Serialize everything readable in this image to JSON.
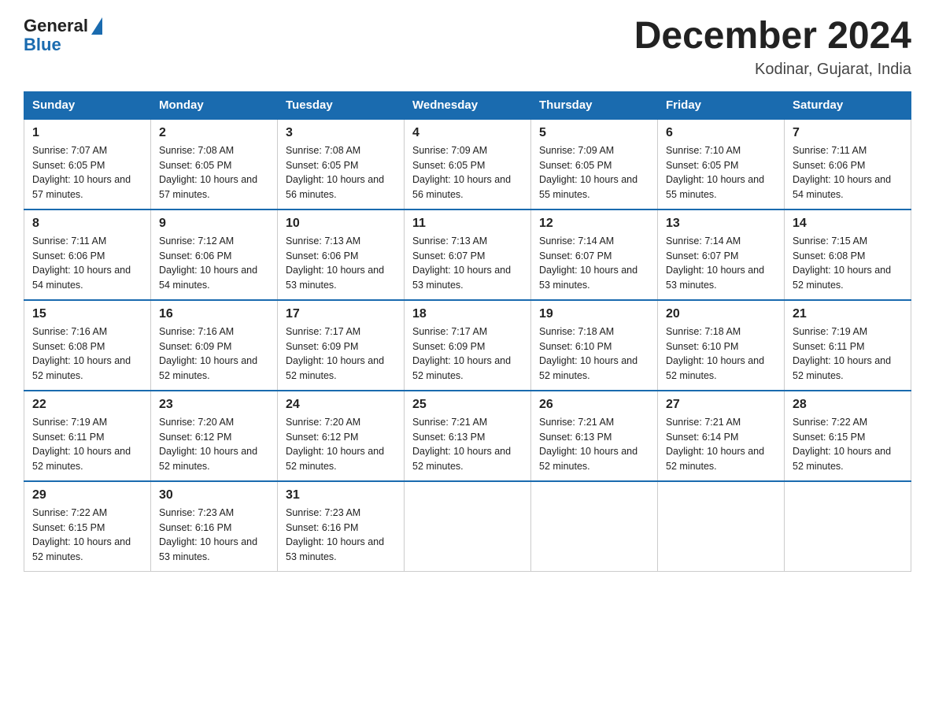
{
  "logo": {
    "general": "General",
    "blue": "Blue"
  },
  "header": {
    "month": "December 2024",
    "location": "Kodinar, Gujarat, India"
  },
  "days_of_week": [
    "Sunday",
    "Monday",
    "Tuesday",
    "Wednesday",
    "Thursday",
    "Friday",
    "Saturday"
  ],
  "weeks": [
    [
      {
        "day": "1",
        "sunrise": "7:07 AM",
        "sunset": "6:05 PM",
        "daylight": "10 hours and 57 minutes."
      },
      {
        "day": "2",
        "sunrise": "7:08 AM",
        "sunset": "6:05 PM",
        "daylight": "10 hours and 57 minutes."
      },
      {
        "day": "3",
        "sunrise": "7:08 AM",
        "sunset": "6:05 PM",
        "daylight": "10 hours and 56 minutes."
      },
      {
        "day": "4",
        "sunrise": "7:09 AM",
        "sunset": "6:05 PM",
        "daylight": "10 hours and 56 minutes."
      },
      {
        "day": "5",
        "sunrise": "7:09 AM",
        "sunset": "6:05 PM",
        "daylight": "10 hours and 55 minutes."
      },
      {
        "day": "6",
        "sunrise": "7:10 AM",
        "sunset": "6:05 PM",
        "daylight": "10 hours and 55 minutes."
      },
      {
        "day": "7",
        "sunrise": "7:11 AM",
        "sunset": "6:06 PM",
        "daylight": "10 hours and 54 minutes."
      }
    ],
    [
      {
        "day": "8",
        "sunrise": "7:11 AM",
        "sunset": "6:06 PM",
        "daylight": "10 hours and 54 minutes."
      },
      {
        "day": "9",
        "sunrise": "7:12 AM",
        "sunset": "6:06 PM",
        "daylight": "10 hours and 54 minutes."
      },
      {
        "day": "10",
        "sunrise": "7:13 AM",
        "sunset": "6:06 PM",
        "daylight": "10 hours and 53 minutes."
      },
      {
        "day": "11",
        "sunrise": "7:13 AM",
        "sunset": "6:07 PM",
        "daylight": "10 hours and 53 minutes."
      },
      {
        "day": "12",
        "sunrise": "7:14 AM",
        "sunset": "6:07 PM",
        "daylight": "10 hours and 53 minutes."
      },
      {
        "day": "13",
        "sunrise": "7:14 AM",
        "sunset": "6:07 PM",
        "daylight": "10 hours and 53 minutes."
      },
      {
        "day": "14",
        "sunrise": "7:15 AM",
        "sunset": "6:08 PM",
        "daylight": "10 hours and 52 minutes."
      }
    ],
    [
      {
        "day": "15",
        "sunrise": "7:16 AM",
        "sunset": "6:08 PM",
        "daylight": "10 hours and 52 minutes."
      },
      {
        "day": "16",
        "sunrise": "7:16 AM",
        "sunset": "6:09 PM",
        "daylight": "10 hours and 52 minutes."
      },
      {
        "day": "17",
        "sunrise": "7:17 AM",
        "sunset": "6:09 PM",
        "daylight": "10 hours and 52 minutes."
      },
      {
        "day": "18",
        "sunrise": "7:17 AM",
        "sunset": "6:09 PM",
        "daylight": "10 hours and 52 minutes."
      },
      {
        "day": "19",
        "sunrise": "7:18 AM",
        "sunset": "6:10 PM",
        "daylight": "10 hours and 52 minutes."
      },
      {
        "day": "20",
        "sunrise": "7:18 AM",
        "sunset": "6:10 PM",
        "daylight": "10 hours and 52 minutes."
      },
      {
        "day": "21",
        "sunrise": "7:19 AM",
        "sunset": "6:11 PM",
        "daylight": "10 hours and 52 minutes."
      }
    ],
    [
      {
        "day": "22",
        "sunrise": "7:19 AM",
        "sunset": "6:11 PM",
        "daylight": "10 hours and 52 minutes."
      },
      {
        "day": "23",
        "sunrise": "7:20 AM",
        "sunset": "6:12 PM",
        "daylight": "10 hours and 52 minutes."
      },
      {
        "day": "24",
        "sunrise": "7:20 AM",
        "sunset": "6:12 PM",
        "daylight": "10 hours and 52 minutes."
      },
      {
        "day": "25",
        "sunrise": "7:21 AM",
        "sunset": "6:13 PM",
        "daylight": "10 hours and 52 minutes."
      },
      {
        "day": "26",
        "sunrise": "7:21 AM",
        "sunset": "6:13 PM",
        "daylight": "10 hours and 52 minutes."
      },
      {
        "day": "27",
        "sunrise": "7:21 AM",
        "sunset": "6:14 PM",
        "daylight": "10 hours and 52 minutes."
      },
      {
        "day": "28",
        "sunrise": "7:22 AM",
        "sunset": "6:15 PM",
        "daylight": "10 hours and 52 minutes."
      }
    ],
    [
      {
        "day": "29",
        "sunrise": "7:22 AM",
        "sunset": "6:15 PM",
        "daylight": "10 hours and 52 minutes."
      },
      {
        "day": "30",
        "sunrise": "7:23 AM",
        "sunset": "6:16 PM",
        "daylight": "10 hours and 53 minutes."
      },
      {
        "day": "31",
        "sunrise": "7:23 AM",
        "sunset": "6:16 PM",
        "daylight": "10 hours and 53 minutes."
      },
      null,
      null,
      null,
      null
    ]
  ]
}
